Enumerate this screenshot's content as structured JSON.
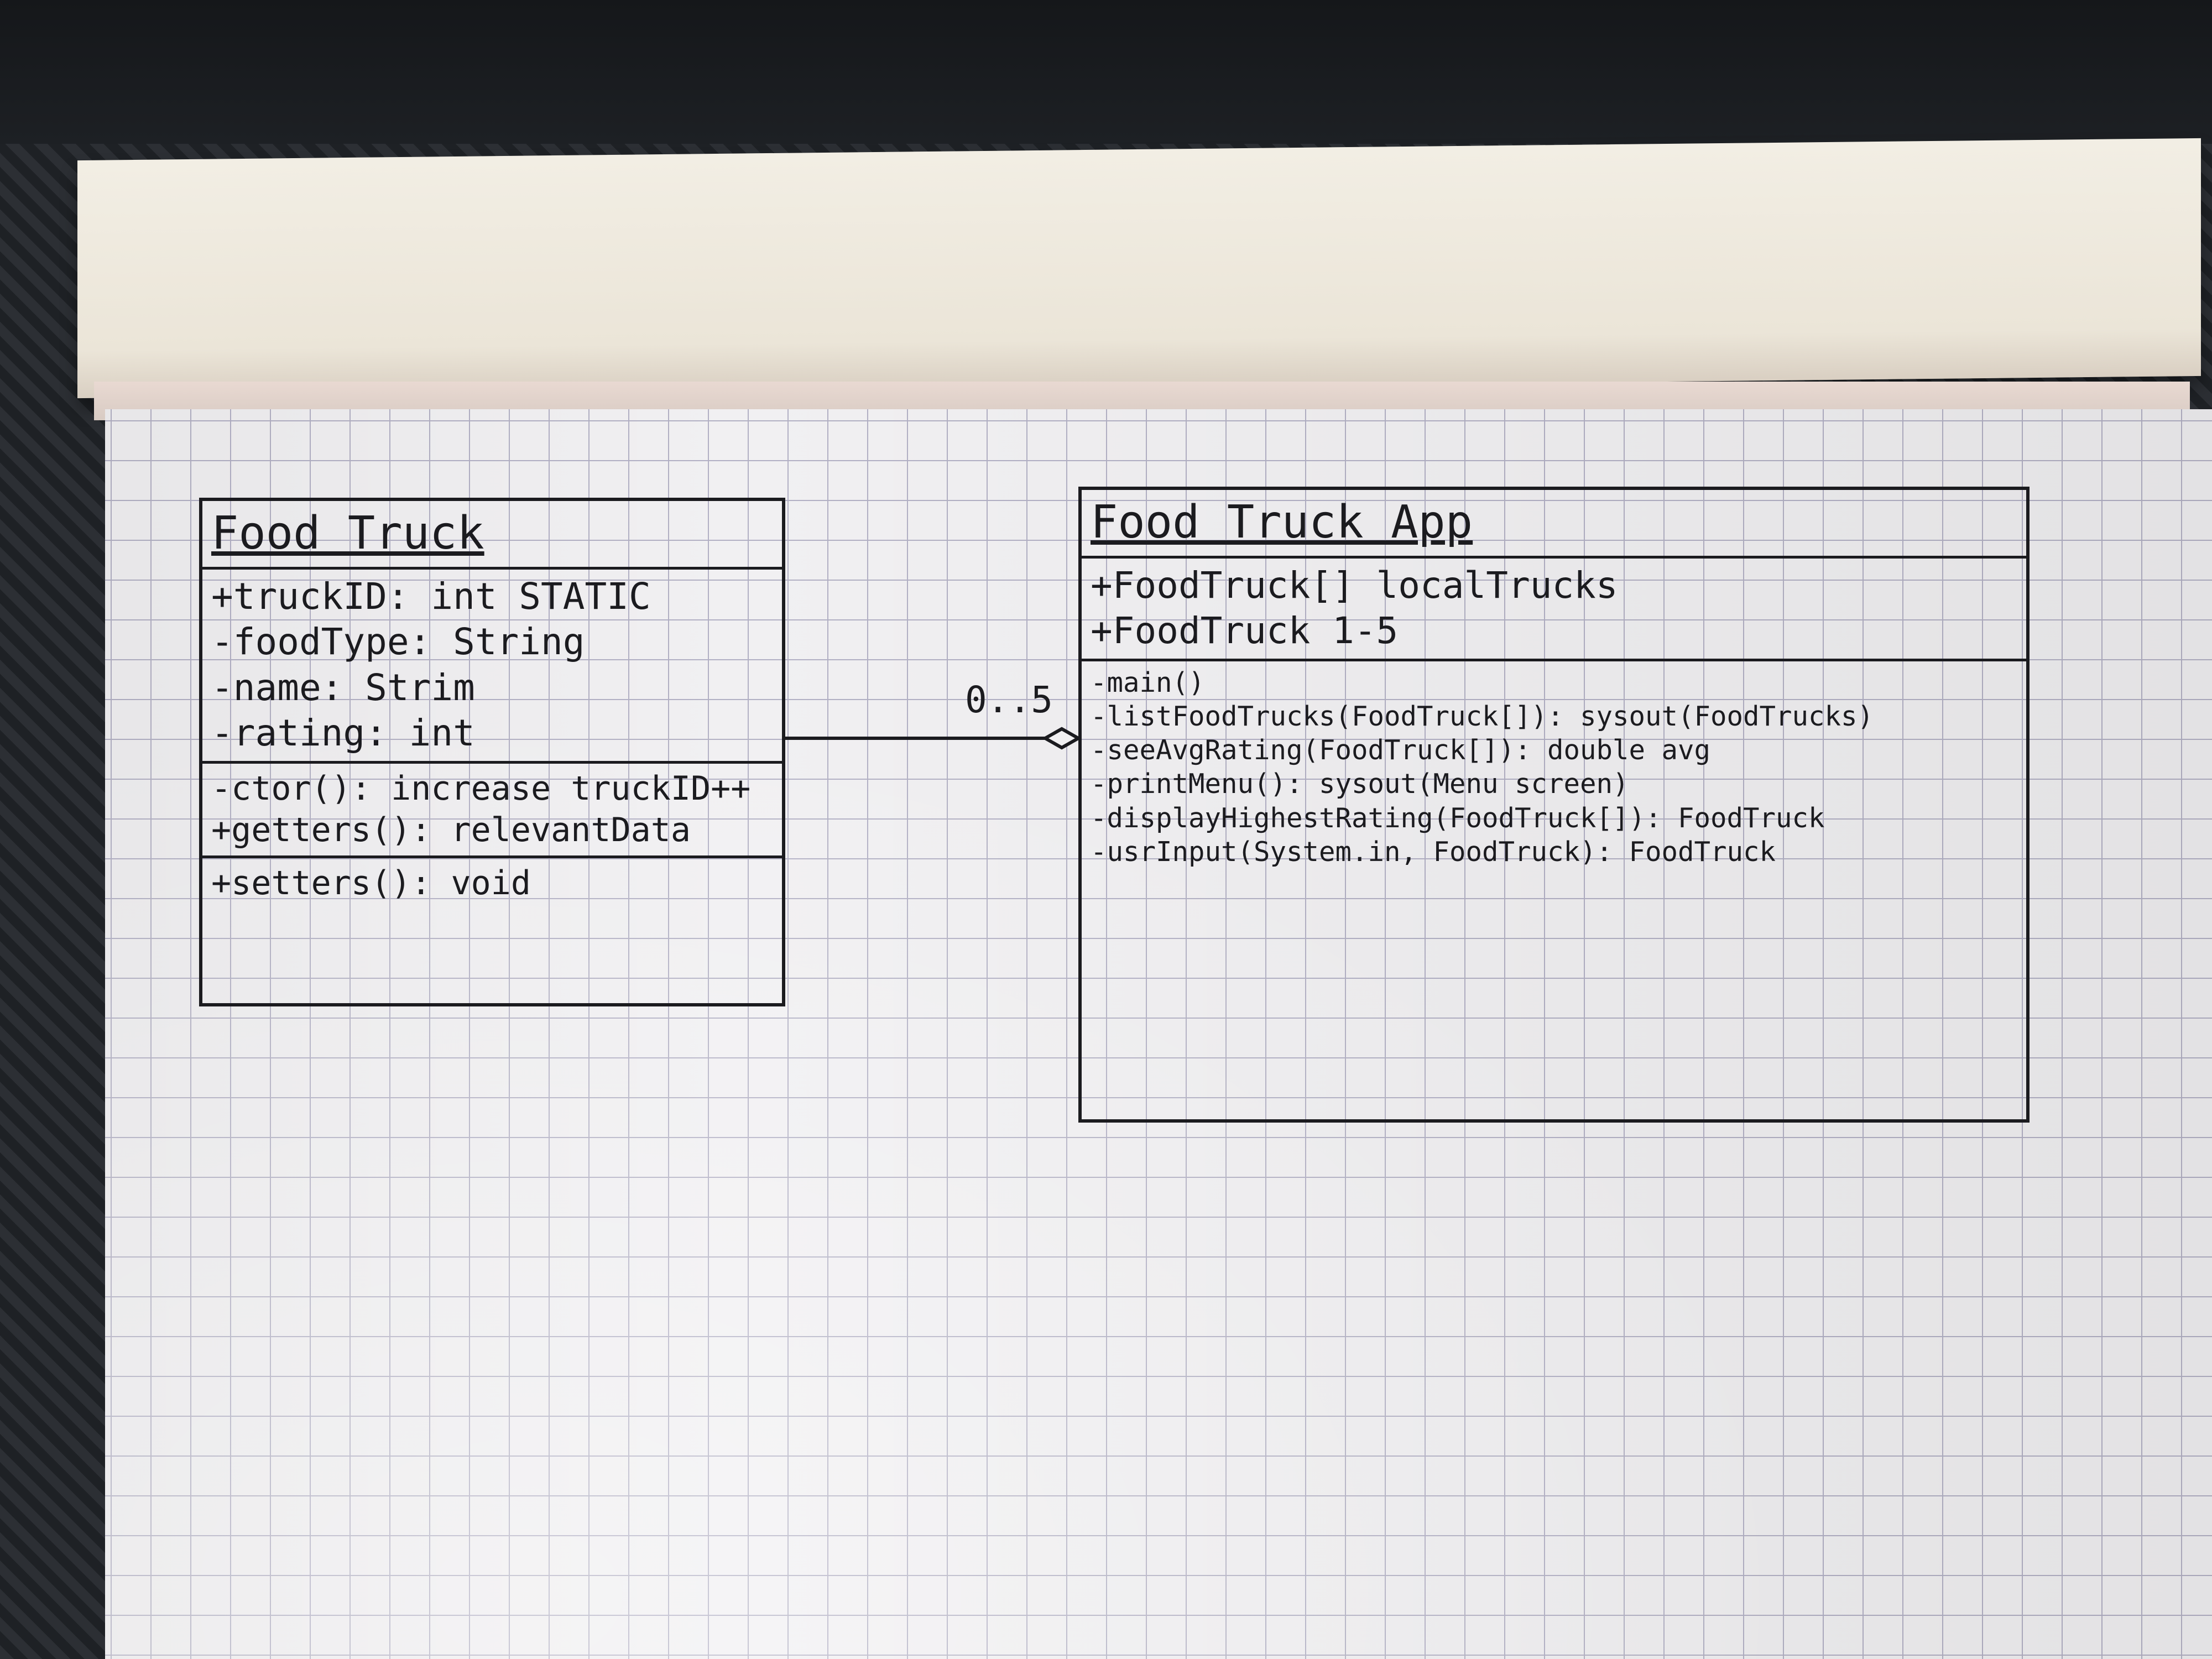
{
  "diagram": {
    "food_truck": {
      "title": "Food Truck",
      "attributes": [
        "+truckID: int STATIC",
        "-foodType: String",
        "-name: Strim",
        "-rating: int"
      ],
      "methods": [
        "-ctor(): increase truckID++",
        "+getters(): relevantData",
        "+setters(): void"
      ]
    },
    "food_truck_app": {
      "title": "Food Truck App",
      "attributes": [
        "+FoodTruck[] localTrucks",
        "+FoodTruck 1-5"
      ],
      "methods": [
        "-main()",
        "-listFoodTrucks(FoodTruck[]): sysout(FoodTrucks)",
        "-seeAvgRating(FoodTruck[]): double avg",
        "-printMenu(): sysout(Menu screen)",
        "-displayHighestRating(FoodTruck[]): FoodTruck",
        "-usrInput(System.in, FoodTruck): FoodTruck"
      ]
    },
    "association": {
      "multiplicity": "0..5",
      "type": "aggregation"
    }
  },
  "colors": {
    "ink": "#1b1b1f",
    "grid": "#b2b0c4",
    "paper": "#f1f0f2"
  }
}
